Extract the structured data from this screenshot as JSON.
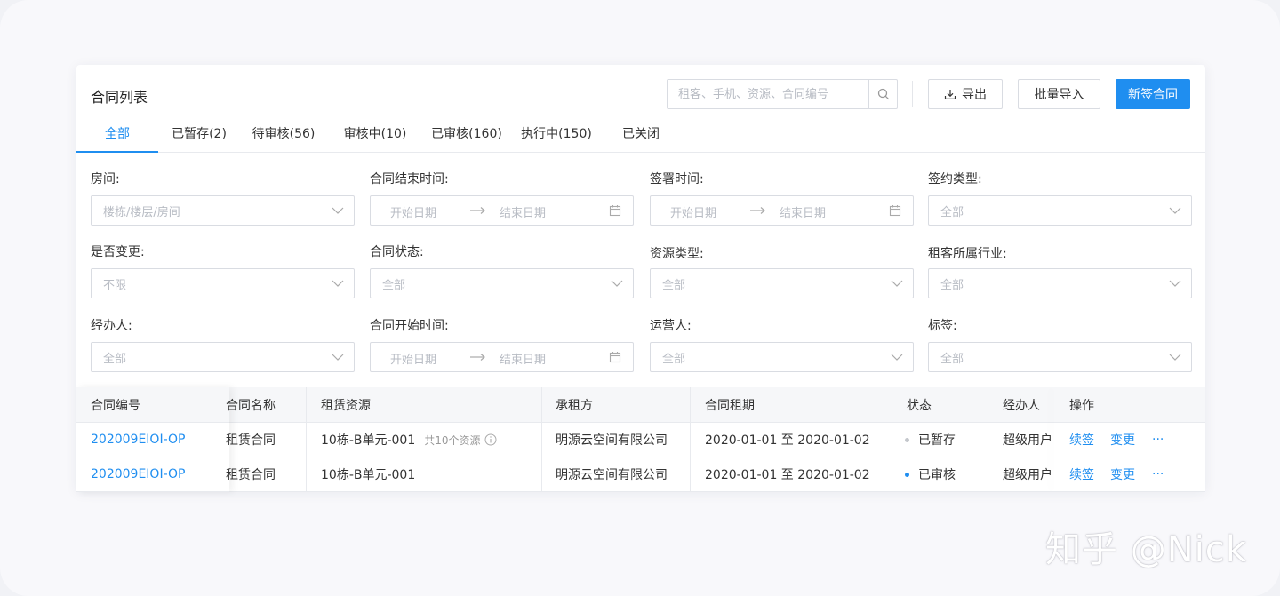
{
  "header": {
    "title": "合同列表",
    "search_placeholder": "租客、手机、资源、合同编号",
    "export_label": "导出",
    "import_label": "批量导入",
    "new_label": "新签合同"
  },
  "tabs": [
    {
      "label": "全部",
      "active": true
    },
    {
      "label": "已暂存(2)"
    },
    {
      "label": "待审核(56)"
    },
    {
      "label": "审核中(10)"
    },
    {
      "label": "已审核(160)"
    },
    {
      "label": "执行中(150)"
    },
    {
      "label": "已关闭"
    }
  ],
  "filters": {
    "room": {
      "label": "房间:",
      "placeholder": "楼栋/楼层/房间"
    },
    "end_time": {
      "label": "合同结束时间:",
      "start": "开始日期",
      "end": "结束日期"
    },
    "sign_time": {
      "label": "签署时间:",
      "start": "开始日期",
      "end": "结束日期"
    },
    "sign_type": {
      "label": "签约类型:",
      "placeholder": "全部"
    },
    "changed": {
      "label": "是否变更:",
      "placeholder": "不限"
    },
    "status": {
      "label": "合同状态:",
      "placeholder": "全部"
    },
    "resource_type": {
      "label": "资源类型:",
      "placeholder": "全部"
    },
    "industry": {
      "label": "租客所属行业:",
      "placeholder": "全部"
    },
    "handler": {
      "label": "经办人:",
      "placeholder": "全部"
    },
    "start_time": {
      "label": "合同开始时间:",
      "start": "开始日期",
      "end": "结束日期"
    },
    "operator": {
      "label": "运营人:",
      "placeholder": "全部"
    },
    "tag": {
      "label": "标签:",
      "placeholder": "全部"
    }
  },
  "table": {
    "columns": [
      "合同编号",
      "合同名称",
      "租赁资源",
      "承租方",
      "合同租期",
      "状态",
      "经办人",
      "操作"
    ],
    "rows": [
      {
        "id": "202009EIOI-OP",
        "name": "租赁合同",
        "resource": "10栋-B单元-001",
        "resource_hint": "共10个资源",
        "tenant": "明源云空间有限公司",
        "period": "2020-01-01 至 2020-01-02",
        "status": "已暂存",
        "status_color": "#c4c7cc",
        "handler": "超级用户",
        "actions": [
          "续签",
          "变更",
          "···"
        ]
      },
      {
        "id": "202009EIOI-OP",
        "name": "租赁合同",
        "resource": "10栋-B单元-001",
        "resource_hint": "",
        "tenant": "明源云空间有限公司",
        "period": "2020-01-01 至 2020-01-02",
        "status": "已审核",
        "status_color": "#1f8ef0",
        "handler": "超级用户",
        "actions": [
          "续签",
          "变更",
          "···"
        ]
      }
    ]
  },
  "watermark": "知乎 @Nick",
  "colors": {
    "accent": "#1f8ef0",
    "border": "#d9dce2",
    "header_bg": "#f6f7f9"
  }
}
